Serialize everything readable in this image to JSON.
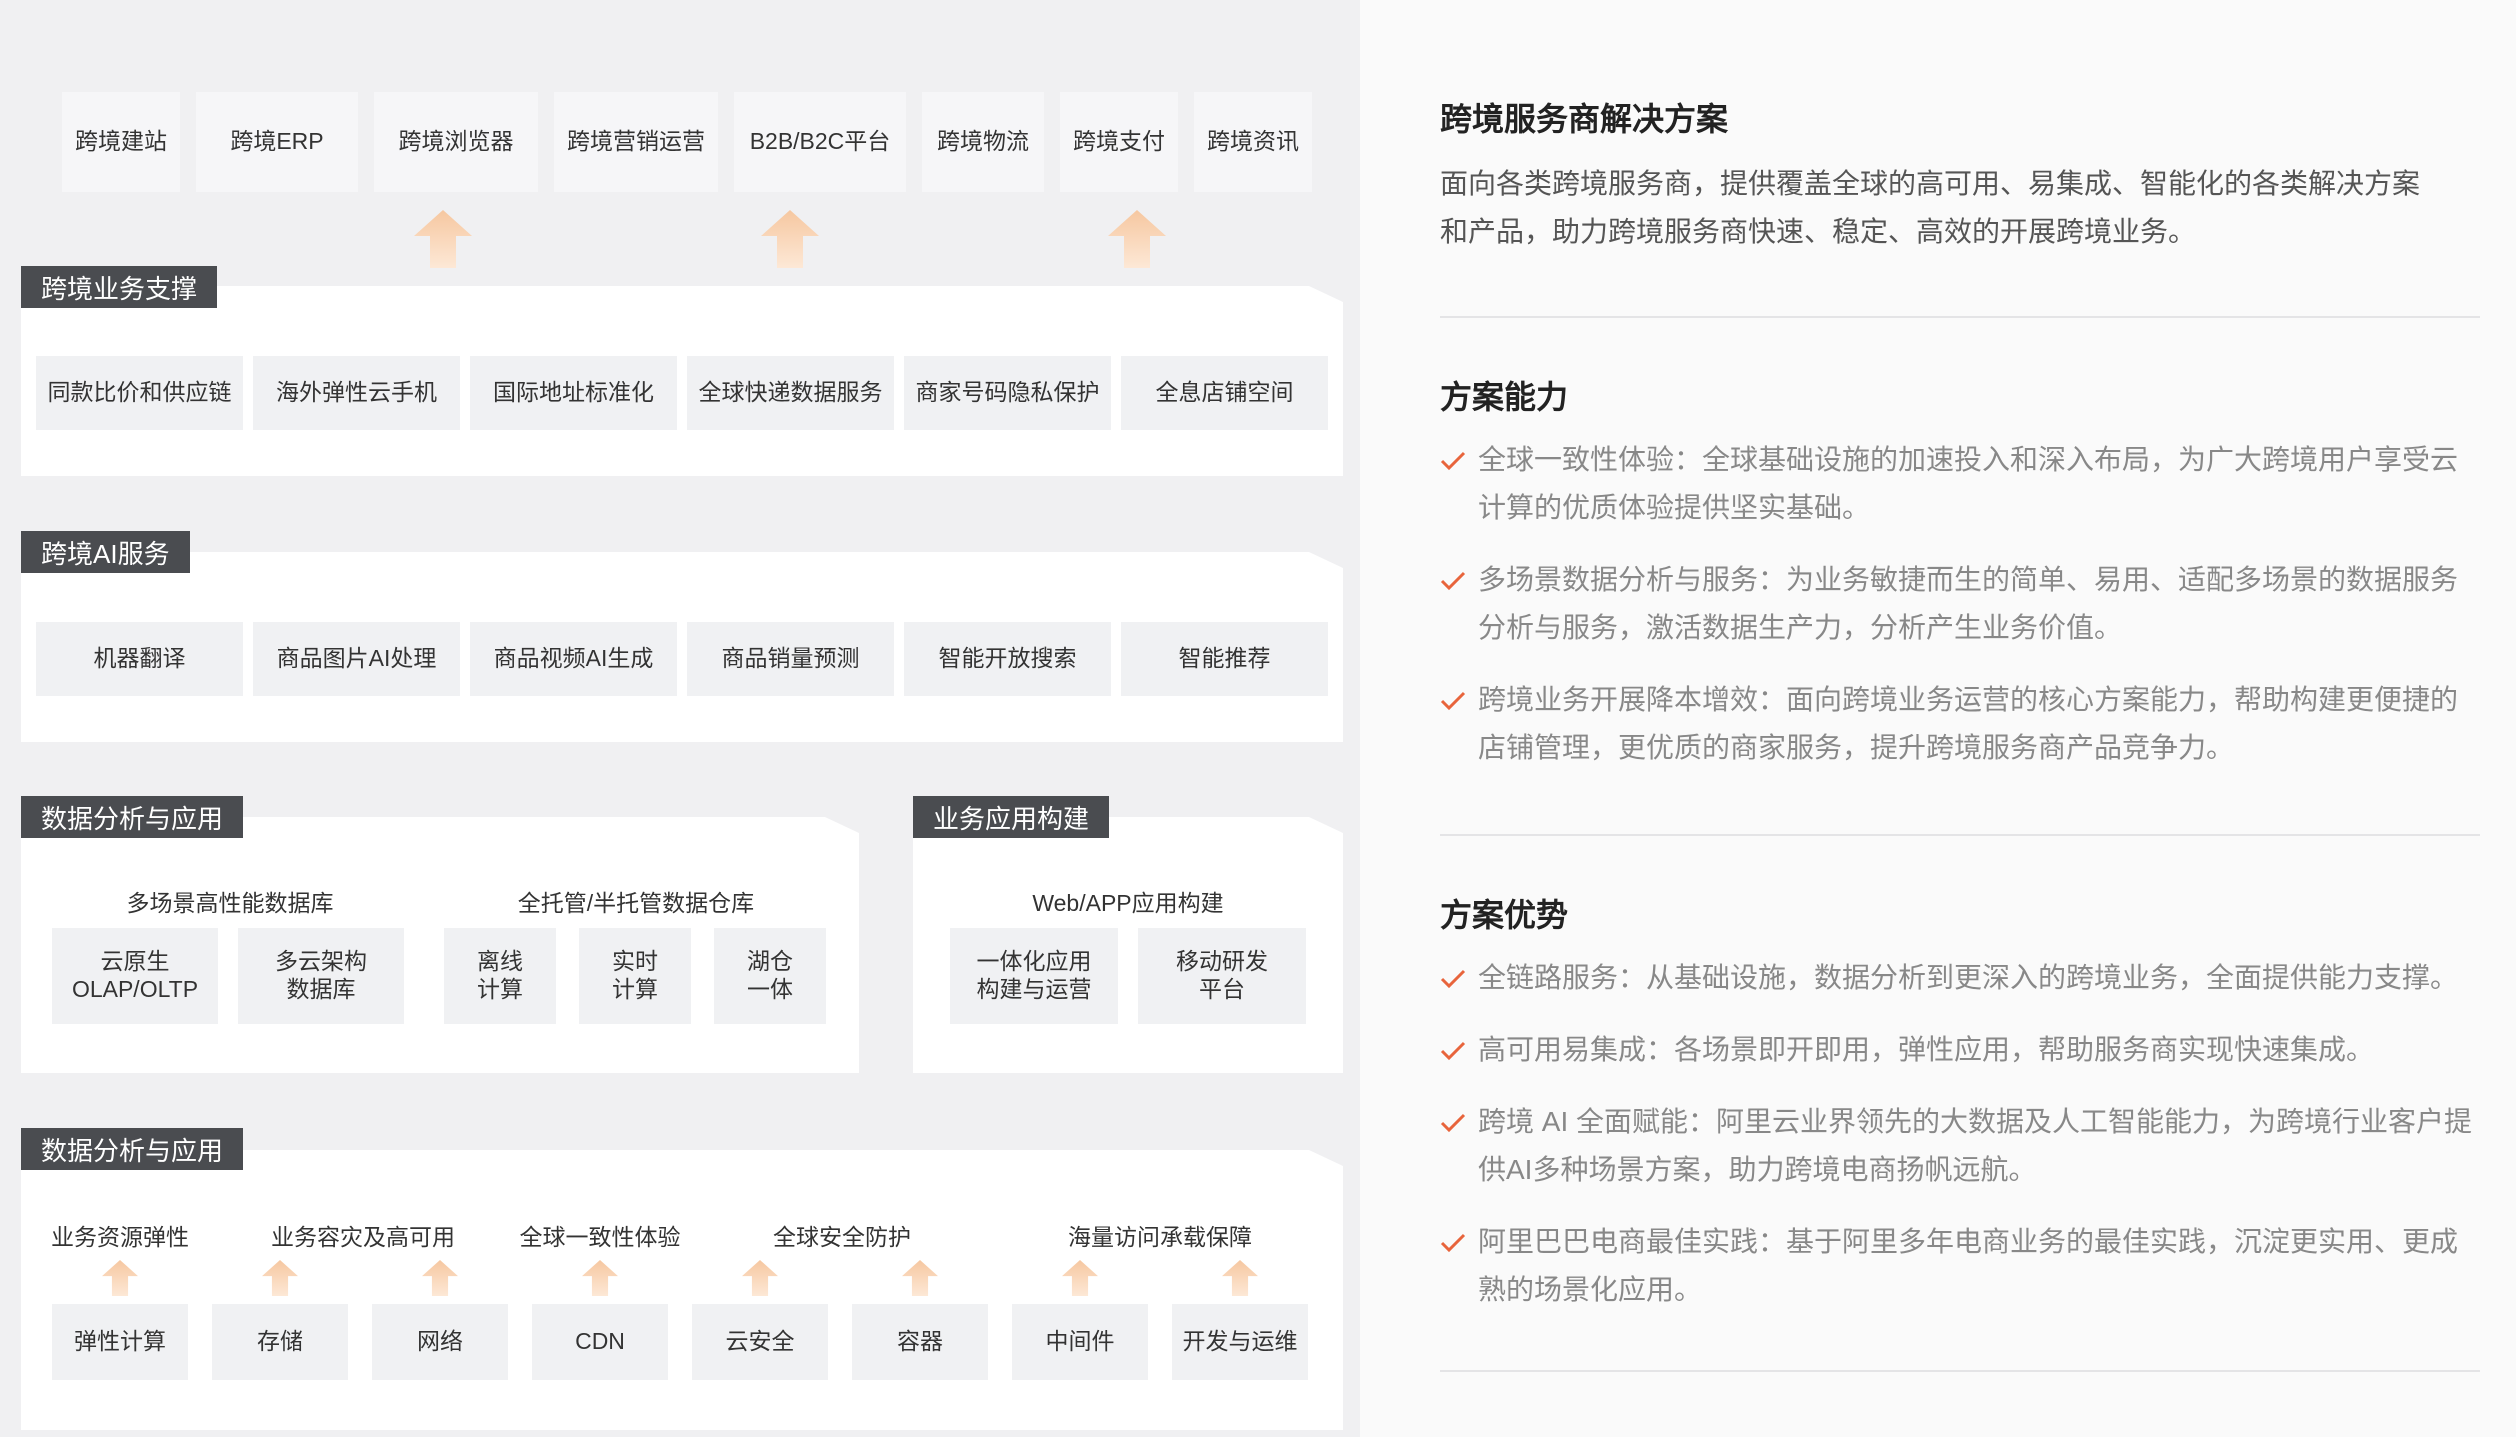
{
  "top_row": [
    "跨境建站",
    "跨境ERP",
    "跨境浏览器",
    "跨境营销运营",
    "B2B/B2C平台",
    "跨境物流",
    "跨境支付",
    "跨境资讯"
  ],
  "section_business": {
    "tag": "跨境业务支撑",
    "items": [
      "同款比价和供应链",
      "海外弹性云手机",
      "国际地址标准化",
      "全球快递数据服务",
      "商家号码隐私保护",
      "全息店铺空间"
    ]
  },
  "section_ai": {
    "tag": "跨境AI服务",
    "items": [
      "机器翻译",
      "商品图片AI处理",
      "商品视频AI生成",
      "商品销量预测",
      "智能开放搜索",
      "智能推荐"
    ]
  },
  "section_data": {
    "tag": "数据分析与应用",
    "group1_title": "多场景高性能数据库",
    "group1_items": [
      "云原生\nOLAP/OLTP",
      "多云架构\n数据库"
    ],
    "group2_title": "全托管/半托管数据仓库",
    "group2_items": [
      "离线\n计算",
      "实时\n计算",
      "湖仓\n一体"
    ]
  },
  "section_app": {
    "tag": "业务应用构建",
    "title": "Web/APP应用构建",
    "items": [
      "一体化应用\n构建与运营",
      "移动研发\n平台"
    ]
  },
  "section_infra": {
    "tag": "数据分析与应用",
    "labels": [
      "业务资源弹性",
      "业务容灾及高可用",
      "全球一致性体验",
      "全球安全防护",
      "海量访问承载保障"
    ],
    "items": [
      "弹性计算",
      "存储",
      "网络",
      "CDN",
      "云安全",
      "容器",
      "中间件",
      "开发与运维"
    ]
  },
  "right": {
    "title": "跨境服务商解决方案",
    "intro": "面向各类跨境服务商，提供覆盖全球的高可用、易集成、智能化的各类解决方案和产品，助力跨境服务商快速、稳定、高效的开展跨境业务。",
    "capability_title": "方案能力",
    "capabilities": [
      "全球一致性体验：全球基础设施的加速投入和深入布局，为广大跨境用户享受云计算的优质体验提供坚实基础。",
      "多场景数据分析与服务：为业务敏捷而生的简单、易用、适配多场景的数据服务分析与服务，激活数据生产力，分析产生业务价值。",
      "跨境业务开展降本增效：面向跨境业务运营的核心方案能力，帮助构建更便捷的店铺管理，更优质的商家服务，提升跨境服务商产品竞争力。"
    ],
    "advantage_title": "方案优势",
    "advantages": [
      "全链路服务：从基础设施，数据分析到更深入的跨境业务，全面提供能力支撑。",
      "高可用易集成：各场景即开即用，弹性应用，帮助服务商实现快速集成。",
      "跨境 AI 全面赋能：阿里云业界领先的大数据及人工智能能力，为跨境行业客户提供AI多种场景方案，助力跨境电商扬帆远航。",
      "阿里巴巴电商最佳实践：基于阿里多年电商业务的最佳实践，沉淀更实用、更成熟的场景化应用。"
    ]
  },
  "colors": {
    "tag_bg": "#4a4c50",
    "check": "#e8643c",
    "arrow_top": "#f6c7a0",
    "arrow_bottom": "#fde8d6"
  }
}
